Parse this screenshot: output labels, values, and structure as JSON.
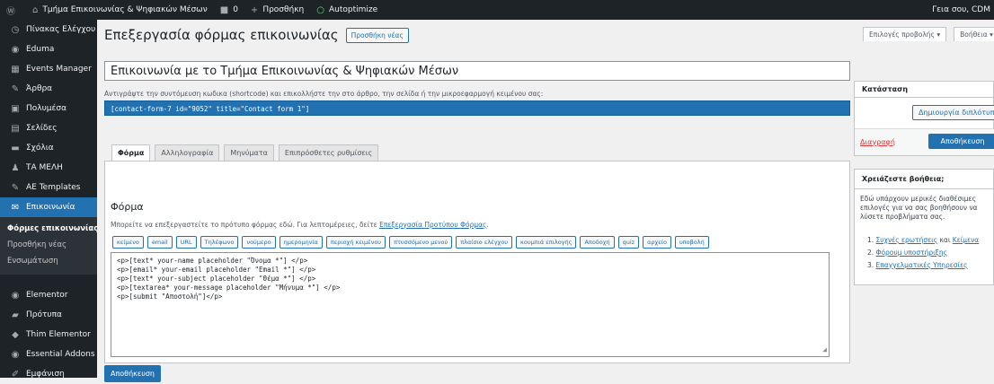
{
  "admin_bar": {
    "site_name": "Τμήμα Επικοινωνίας & Ψηφιακών Μέσων",
    "comments_count": "0",
    "new_label": "Προσθήκη",
    "autoptimize_label": "Autoptimize",
    "greeting": "Γεια σου, CDM"
  },
  "sidebar": {
    "items": [
      {
        "label": "Πίνακας Ελέγχου",
        "icon": "dashboard-icon"
      },
      {
        "label": "Eduma",
        "icon": "eduma-icon"
      },
      {
        "label": "Events Manager",
        "icon": "calendar-icon"
      },
      {
        "label": "Άρθρα",
        "icon": "pin-icon"
      },
      {
        "label": "Πολυμέσα",
        "icon": "media-icon"
      },
      {
        "label": "Σελίδες",
        "icon": "pages-icon"
      },
      {
        "label": "Σχόλια",
        "icon": "comments-icon"
      },
      {
        "label": "ΤΑ ΜΕΛΗ",
        "icon": "users-icon"
      },
      {
        "label": "AE Templates",
        "icon": "pin-icon"
      },
      {
        "label": "Επικοινωνία",
        "icon": "mail-icon"
      }
    ],
    "submenu": [
      "Φόρμες επικοινωνίας",
      "Προσθήκη νέας",
      "Ενσωμάτωση"
    ],
    "items_after": [
      {
        "label": "Elementor",
        "icon": "elementor-icon"
      },
      {
        "label": "Πρότυπα",
        "icon": "folder-icon"
      },
      {
        "label": "Thim Elementor",
        "icon": "thim-icon"
      },
      {
        "label": "Essential Addons",
        "icon": "ea-icon"
      },
      {
        "label": "Εμφάνιση",
        "icon": "brush-icon"
      }
    ]
  },
  "main": {
    "page_title": "Επεξεργασία φόρμας επικοινωνίας",
    "add_new_label": "Προσθήκη νέας",
    "form_title_value": "Επικοινωνία με το Τμήμα Επικοινωνίας & Ψηφιακών Μέσων",
    "shortcode_hint": "Αντιγράψτε την συντόμευση κωδικα (shortcode) και επικολλήστε την στο άρθρο, την σελίδα ή την μικροεφαρμογή κειμένου σας:",
    "shortcode": "[contact-form-7 id=\"9052\" title=\"Contact form 1\"]",
    "tabs": [
      "Φόρμα",
      "Αλληλογραφία",
      "Μηνύματα",
      "Επιπρόσθετες ρυθμίσεις"
    ],
    "panel_title": "Φόρμα",
    "panel_desc": "Μπορείτε να επεξεργαστείτε το πρότυπο φόρμας εδώ. Για λεπτομέρειες, δείτε ",
    "panel_link": "Επεξεργασία Προτύπου Φόρμας",
    "panel_desc_end": ".",
    "tag_buttons": [
      "κείμενο",
      "email",
      "URL",
      "Τηλέφωνο",
      "νούμερο",
      "ημερομηνία",
      "περιοχή κειμένου",
      "πτυσσόμενο μενού",
      "πλαίσιο ελέγχου",
      "κουμπιά επιλογής",
      "Αποδοχή",
      "quiz",
      "αρχείο",
      "υποβολή"
    ],
    "form_code_lines": [
      "<p>[text* your-name placeholder \"Όνομα *\"] </p>",
      "<p>[email* your-email placeholder \"Email *\"] </p>",
      "<p>[text* your-subject placeholder \"Θέμα *\"] </p>",
      "<p>[textarea* your-message placeholder \"Μήνυμα *\"] </p>",
      "<p>[submit \"Αποστολή\"]</p>"
    ],
    "save_label": "Αποθήκευση"
  },
  "right": {
    "screen_options": "Επιλογές προβολής ▾",
    "help_tab": "Βοήθεια ▾",
    "status_title": "Κατάσταση",
    "duplicate_label": "Δημιουργία διπλότυπου",
    "delete_label": "Διαγραφή",
    "save_label": "Αποθήκευση",
    "help_title": "Χρειάζεστε βοήθεια;",
    "help_text": "Εδώ υπάρχουν μερικές διαθέσιμες επιλογές για να σας βοηθήσουν να λύσετε προβλήματα σας.",
    "help_links": [
      {
        "num": "1.",
        "text": "Συχνές ερωτήσεις",
        "mid": " και ",
        "text2": "Κείμενα"
      },
      {
        "num": "2.",
        "text": "Φόρουμ υποστήριξης"
      },
      {
        "num": "3.",
        "text": "Επαγγελματικές Υπηρεσίες"
      }
    ]
  }
}
